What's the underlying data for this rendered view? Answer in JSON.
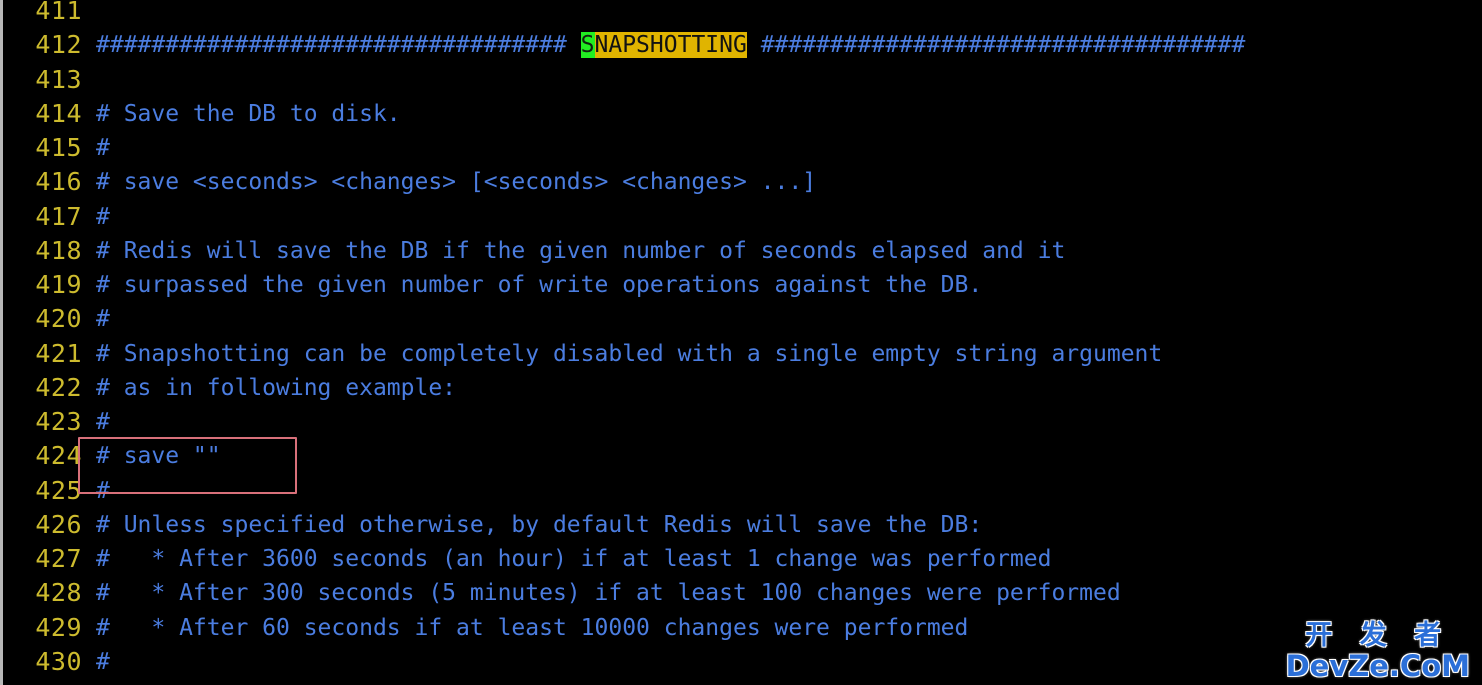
{
  "editor": {
    "filetype": "redis-conf",
    "theme": {
      "background": "#000000",
      "text_color": "#4b7de0",
      "lineno_color": "#cdbb2e",
      "search_highlight_bg": "#e0b400",
      "search_highlight_fg": "#121212",
      "cursor_bg": "#22ee22",
      "annotation_color": "#d8707a"
    },
    "first_visible_line": 411,
    "last_visible_line": 430,
    "cursor_line": 412,
    "search_match": "SNAPSHOTTING"
  },
  "lines": [
    {
      "no": "411",
      "text": ""
    },
    {
      "no": "412",
      "pre": "################################## ",
      "cursor": "S",
      "match": "NAPSHOTTING",
      "post": " ###################################"
    },
    {
      "no": "413",
      "text": ""
    },
    {
      "no": "414",
      "text": "# Save the DB to disk."
    },
    {
      "no": "415",
      "text": "#"
    },
    {
      "no": "416",
      "text": "# save <seconds> <changes> [<seconds> <changes> ...]"
    },
    {
      "no": "417",
      "text": "#"
    },
    {
      "no": "418",
      "text": "# Redis will save the DB if the given number of seconds elapsed and it"
    },
    {
      "no": "419",
      "text": "# surpassed the given number of write operations against the DB."
    },
    {
      "no": "420",
      "text": "#"
    },
    {
      "no": "421",
      "text": "# Snapshotting can be completely disabled with a single empty string argument"
    },
    {
      "no": "422",
      "text": "# as in following example:"
    },
    {
      "no": "423",
      "text": "#"
    },
    {
      "no": "424",
      "text": "# save \"\""
    },
    {
      "no": "425",
      "text": "#"
    },
    {
      "no": "426",
      "text": "# Unless specified otherwise, by default Redis will save the DB:"
    },
    {
      "no": "427",
      "text": "#   * After 3600 seconds (an hour) if at least 1 change was performed"
    },
    {
      "no": "428",
      "text": "#   * After 300 seconds (5 minutes) if at least 100 changes were performed"
    },
    {
      "no": "429",
      "text": "#   * After 60 seconds if at least 10000 changes were performed"
    },
    {
      "no": "430",
      "text": "#"
    }
  ],
  "annotation": {
    "label": "save-line-highlight-box",
    "target_line": "424",
    "target_text": "# save \"\""
  },
  "watermark": {
    "chinese": "开 发 者",
    "latin": "DevZe.CoM"
  }
}
